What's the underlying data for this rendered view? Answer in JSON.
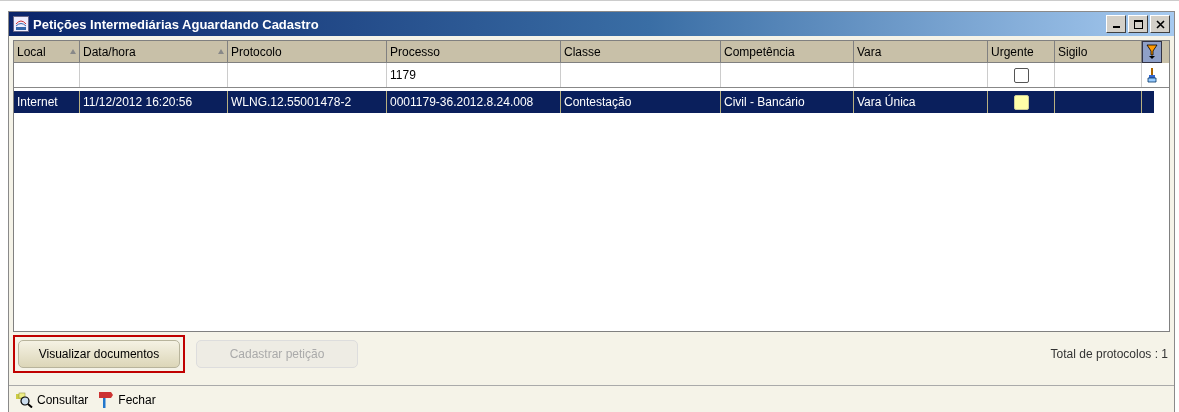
{
  "window": {
    "title": "Petições Intermediárias Aguardando Cadastro"
  },
  "table": {
    "columns": [
      {
        "label": "Local",
        "sorted": true
      },
      {
        "label": "Data/hora",
        "sorted": true
      },
      {
        "label": "Protocolo",
        "sorted": false
      },
      {
        "label": "Processo",
        "sorted": false
      },
      {
        "label": "Classe",
        "sorted": false
      },
      {
        "label": "Competência",
        "sorted": false
      },
      {
        "label": "Vara",
        "sorted": false
      },
      {
        "label": "Urgente",
        "sorted": false
      },
      {
        "label": "Sigilo",
        "sorted": false
      }
    ],
    "filter": {
      "processo": "1179",
      "urgente_checked": false
    },
    "rows": [
      {
        "selected": true,
        "cells": [
          "Internet",
          "11/12/2012 16:20:56",
          "WLNG.12.55001478-2",
          "0001179-36.2012.8.24.008",
          "Contestação",
          "Civil - Bancário",
          "Vara Única"
        ],
        "urgente": false
      }
    ]
  },
  "buttons": [
    {
      "label": "Visualizar documentos",
      "disabled": false,
      "highlighted": true
    },
    {
      "label": "Cadastrar petição",
      "disabled": true,
      "highlighted": false
    }
  ],
  "total": "Total de protocolos : 1",
  "toolbar": [
    {
      "kind": "search",
      "label": "Consultar"
    },
    {
      "kind": "close",
      "label": "Fechar"
    }
  ]
}
